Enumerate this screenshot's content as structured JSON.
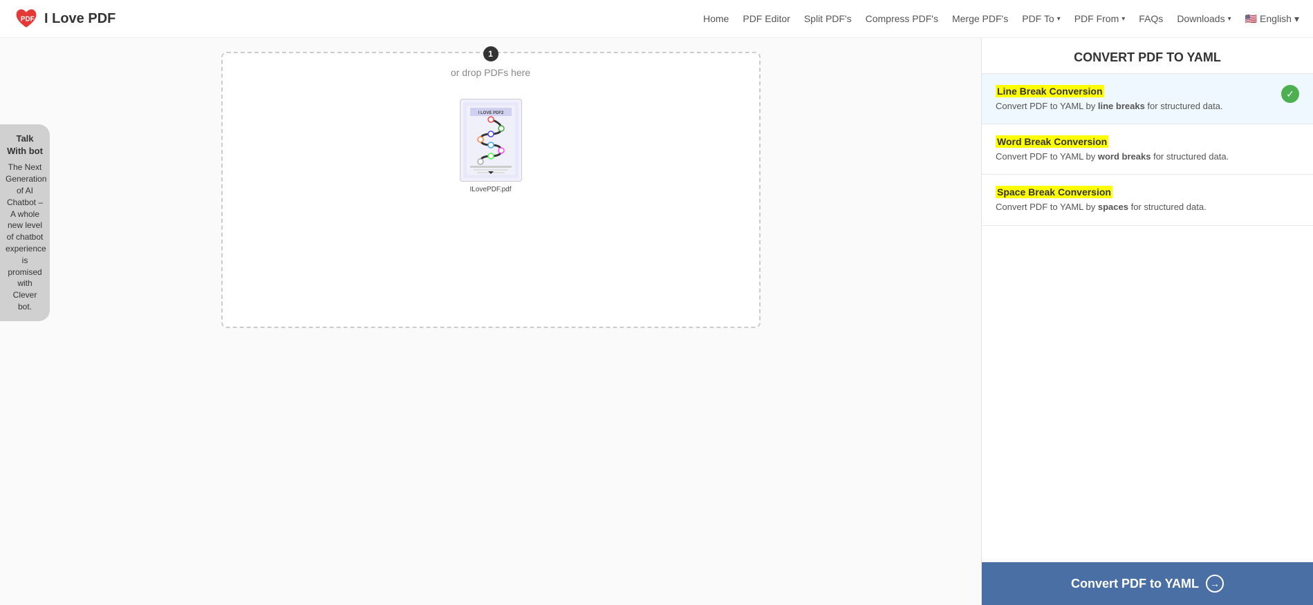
{
  "header": {
    "logo_text": "I Love PDF",
    "nav": {
      "home": "Home",
      "pdf_editor": "PDF Editor",
      "split_pdfs": "Split PDF's",
      "compress_pdfs": "Compress PDF's",
      "merge_pdfs": "Merge PDF's",
      "pdf_to": "PDF To",
      "pdf_from": "PDF From",
      "faqs": "FAQs",
      "downloads": "Downloads",
      "language": "English"
    }
  },
  "chat_widget": {
    "title": "Talk With bot",
    "description": "The Next Generation of AI Chatbot – A whole new level of chatbot experience is promised with Clever bot."
  },
  "upload_zone": {
    "drop_text": "or drop PDFs here",
    "file_count_badge": "1",
    "file_name": "ILovePDF.pdf"
  },
  "right_panel": {
    "title": "CONVERT PDF TO YAML",
    "options": [
      {
        "id": "line_break",
        "title": "Line Break Conversion",
        "desc_before": "Convert PDF to YAML by ",
        "desc_bold": "line breaks",
        "desc_after": " for structured data.",
        "selected": true
      },
      {
        "id": "word_break",
        "title": "Word Break Conversion",
        "desc_before": "Convert PDF to YAML by ",
        "desc_bold": "word breaks",
        "desc_after": " for structured data.",
        "selected": false
      },
      {
        "id": "space_break",
        "title": "Space Break Conversion",
        "desc_before": "Convert PDF to YAML by ",
        "desc_bold": "spaces",
        "desc_after": " for structured data.",
        "selected": false
      }
    ],
    "convert_button": "Convert PDF to YAML"
  }
}
